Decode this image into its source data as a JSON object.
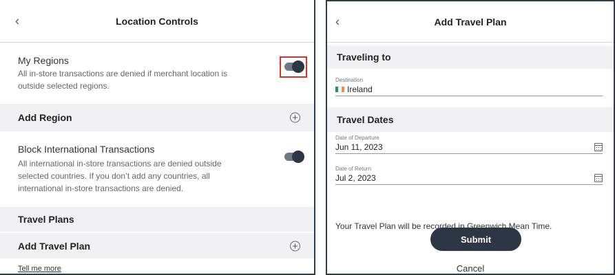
{
  "left_panel": {
    "header": {
      "back_icon": "chevron-left-icon",
      "back_glyph": "‹",
      "title": "Location Controls"
    },
    "my_regions": {
      "label": "My Regions",
      "description": "All in-store transactions are denied if merchant location is outside selected regions.",
      "toggle_on": true
    },
    "add_region": {
      "label": "Add Region",
      "icon": "plus-circle-icon"
    },
    "block_international": {
      "label": "Block International Transactions",
      "description": "All international in-store transactions are denied outside selected countries. If you don’t add any countries, all international in-store transactions are denied.",
      "toggle_on": true
    },
    "travel_plans": {
      "label": "Travel Plans"
    },
    "add_travel_plan": {
      "label": "Add Travel Plan",
      "icon": "plus-circle-icon"
    },
    "tell_me_more": "Tell me more"
  },
  "right_panel": {
    "header": {
      "back_icon": "chevron-left-icon",
      "back_glyph": "‹",
      "title": "Add Travel Plan"
    },
    "traveling_to": {
      "heading": "Traveling to"
    },
    "destination": {
      "label": "Destination",
      "value": "Ireland",
      "flag_colors": [
        "#169b62",
        "#ffffff",
        "#ff883e"
      ]
    },
    "travel_dates": {
      "heading": "Travel Dates"
    },
    "departure": {
      "label": "Date of Departure",
      "value": "Jun 11, 2023"
    },
    "return": {
      "label": "Date of Return",
      "value": "Jul 2, 2023"
    },
    "timezone_note": "Your Travel Plan will be recorded in Greenwich Mean Time.",
    "submit_label": "Submit",
    "cancel_label": "Cancel"
  },
  "colors": {
    "accent": "#2c3644",
    "highlight": "#d9342b",
    "section_bg": "#f1f1f4"
  }
}
